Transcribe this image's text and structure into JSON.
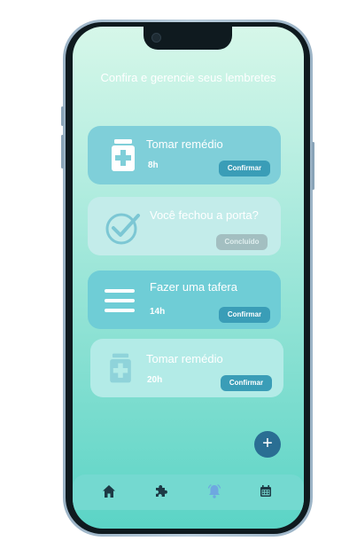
{
  "header": {
    "subtitle": "Confira e gerencie seus lembretes"
  },
  "reminders": [
    {
      "title": "Tomar remédio",
      "time": "8h",
      "button": "Confirmar",
      "icon": "medicine-bottle-icon",
      "status": "pending"
    },
    {
      "title": "Você fechou a porta?",
      "time": "",
      "button": "Concluído",
      "icon": "check-circle-icon",
      "status": "done"
    },
    {
      "title": "Fazer uma tafera",
      "time": "14h",
      "button": "Confirmar",
      "icon": "menu-lines-icon",
      "status": "pending"
    },
    {
      "title": "Tomar remédio",
      "time": "20h",
      "button": "Confirmar",
      "icon": "medicine-bottle-icon",
      "status": "pending"
    }
  ],
  "fab": {
    "label": "+",
    "icon": "plus-icon"
  },
  "tabbar": {
    "items": [
      {
        "name": "home",
        "icon": "home-icon",
        "active": false
      },
      {
        "name": "puzzle",
        "icon": "puzzle-icon",
        "active": false
      },
      {
        "name": "notifications",
        "icon": "bell-icon",
        "active": true
      },
      {
        "name": "calendar",
        "icon": "calendar-icon",
        "active": false
      }
    ]
  },
  "colors": {
    "accent": "#3a9db7",
    "fab": "#2a6e93",
    "active_tab": "#6ea8e0",
    "inactive_tab": "#1d3a45"
  }
}
